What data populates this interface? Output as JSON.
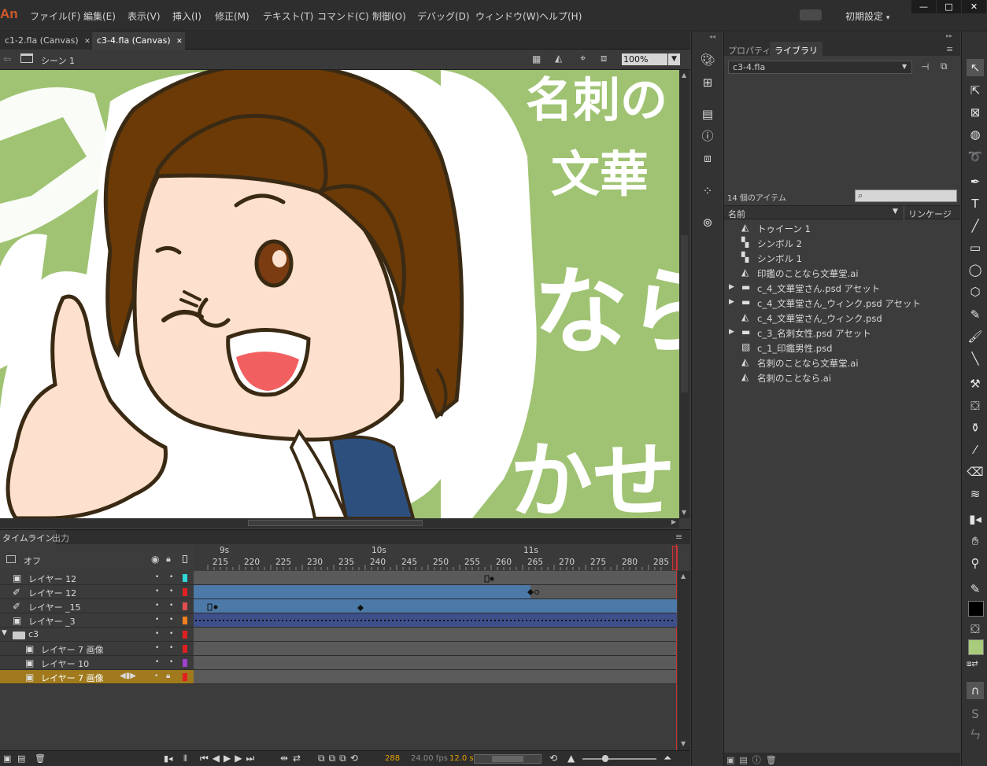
{
  "menubar": {
    "app_logo": "An",
    "items": [
      "ファイル(F)",
      "編集(E)",
      "表示(V)",
      "挿入(I)",
      "修正(M)",
      "テキスト(T)",
      "コマンド(C)",
      "制御(O)",
      "デバッグ(D)",
      "ウィンドウ(W)",
      "ヘルプ(H)"
    ],
    "workspace_preset": "初期設定",
    "window_buttons": [
      "—",
      "□",
      "✕"
    ]
  },
  "doc_tabs": [
    {
      "label": "c1-2.fla (Canvas)",
      "close": "✕",
      "active": false
    },
    {
      "label": "c3-4.fla (Canvas)",
      "close": "✕",
      "active": true
    }
  ],
  "scene": {
    "label": "シーン 1",
    "zoom": "100%"
  },
  "stage_text": [
    "名刺の",
    "文華",
    "なら",
    "かせ"
  ],
  "colors": {
    "stage_bg": "#9fc372",
    "hair": "#6b3a06",
    "skin": "#fde0cd",
    "mouth": "#f25f61",
    "outline": "#3a2a14",
    "shirt": "#2c4f7e",
    "stroke_swatch": "#000000",
    "fill_swatch": "#a8cc7c"
  },
  "timeline": {
    "tabs": [
      "タイムライン",
      "出力"
    ],
    "onion_label": "オフ",
    "ruler_seconds": [
      "9s",
      "10s",
      "11s"
    ],
    "ruler_frames": [
      "215",
      "220",
      "225",
      "230",
      "235",
      "240",
      "245",
      "250",
      "255",
      "260",
      "265",
      "270",
      "275",
      "280",
      "285"
    ],
    "layers": [
      {
        "name": "レイヤー 12",
        "color": "#30d5d5",
        "type": "layer"
      },
      {
        "name": "レイヤー 12",
        "color": "#e02020",
        "type": "guide"
      },
      {
        "name": "レイヤー _15",
        "color": "#e05050",
        "type": "guide"
      },
      {
        "name": "レイヤー _3",
        "color": "#f08020",
        "type": "layer"
      },
      {
        "name": "c3",
        "color": "#e02020",
        "type": "folder"
      },
      {
        "name": "レイヤー 7 画像",
        "color": "#e02020",
        "type": "layer"
      },
      {
        "name": "レイヤー 10",
        "color": "#a040d0",
        "type": "layer"
      },
      {
        "name": "レイヤー 7 画像",
        "color": "#e02020",
        "type": "layer",
        "selected": true
      }
    ],
    "footer": {
      "frame": "288",
      "fps": "24.00 fps",
      "time": "12.0 s"
    }
  },
  "right_panel": {
    "tabs": [
      "プロパティ",
      "ライブラリ"
    ],
    "doc_select": "c3-4.fla",
    "item_count": "14 個のアイテム",
    "col_name": "名前",
    "col_linkage": "リンケージ",
    "library_items": [
      {
        "name": "トゥイーン 1",
        "icon": "graphic-symbol-icon",
        "expand": false
      },
      {
        "name": "シンボル 2",
        "icon": "movieclip-icon",
        "expand": false
      },
      {
        "name": "シンボル 1",
        "icon": "movieclip-icon",
        "expand": false
      },
      {
        "name": "印鑑のことなら文華堂.ai",
        "icon": "graphic-symbol-icon",
        "expand": false
      },
      {
        "name": "c_4_文華堂さん.psd アセット",
        "icon": "folder-icon",
        "expand": true
      },
      {
        "name": "c_4_文華堂さん_ウィンク.psd アセット",
        "icon": "folder-icon",
        "expand": true
      },
      {
        "name": "c_4_文華堂さん_ウィンク.psd",
        "icon": "graphic-symbol-icon",
        "expand": false
      },
      {
        "name": "c_3_名刺女性.psd アセット",
        "icon": "folder-icon",
        "expand": true
      },
      {
        "name": "c_1_印鑑男性.psd",
        "icon": "bitmap-icon",
        "expand": false
      },
      {
        "name": "名刺のことなら文華堂.ai",
        "icon": "graphic-symbol-icon",
        "expand": false
      },
      {
        "name": "名刺のことなら.ai",
        "icon": "graphic-symbol-icon",
        "expand": false
      }
    ]
  },
  "tools_text": [
    "T",
    "S",
    "ㄣ"
  ]
}
